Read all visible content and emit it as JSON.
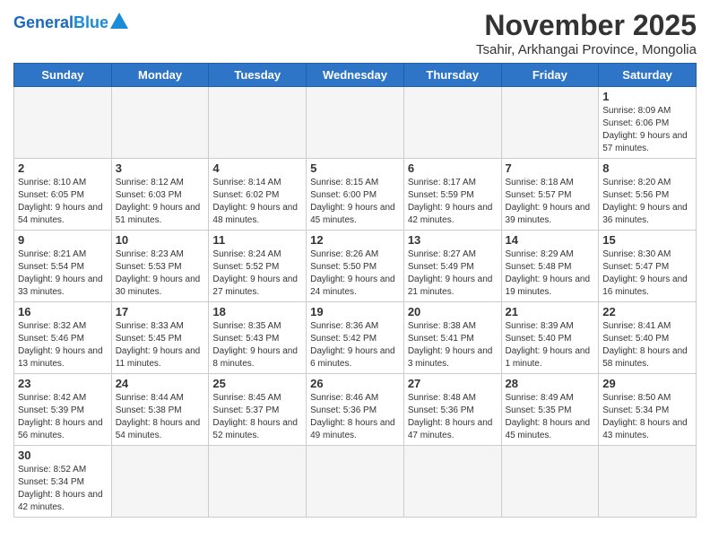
{
  "header": {
    "logo_general": "General",
    "logo_blue": "Blue",
    "month_title": "November 2025",
    "location": "Tsahir, Arkhangai Province, Mongolia"
  },
  "weekdays": [
    "Sunday",
    "Monday",
    "Tuesday",
    "Wednesday",
    "Thursday",
    "Friday",
    "Saturday"
  ],
  "weeks": [
    [
      {
        "day": "",
        "info": ""
      },
      {
        "day": "",
        "info": ""
      },
      {
        "day": "",
        "info": ""
      },
      {
        "day": "",
        "info": ""
      },
      {
        "day": "",
        "info": ""
      },
      {
        "day": "",
        "info": ""
      },
      {
        "day": "1",
        "info": "Sunrise: 8:09 AM\nSunset: 6:06 PM\nDaylight: 9 hours and 57 minutes."
      }
    ],
    [
      {
        "day": "2",
        "info": "Sunrise: 8:10 AM\nSunset: 6:05 PM\nDaylight: 9 hours and 54 minutes."
      },
      {
        "day": "3",
        "info": "Sunrise: 8:12 AM\nSunset: 6:03 PM\nDaylight: 9 hours and 51 minutes."
      },
      {
        "day": "4",
        "info": "Sunrise: 8:14 AM\nSunset: 6:02 PM\nDaylight: 9 hours and 48 minutes."
      },
      {
        "day": "5",
        "info": "Sunrise: 8:15 AM\nSunset: 6:00 PM\nDaylight: 9 hours and 45 minutes."
      },
      {
        "day": "6",
        "info": "Sunrise: 8:17 AM\nSunset: 5:59 PM\nDaylight: 9 hours and 42 minutes."
      },
      {
        "day": "7",
        "info": "Sunrise: 8:18 AM\nSunset: 5:57 PM\nDaylight: 9 hours and 39 minutes."
      },
      {
        "day": "8",
        "info": "Sunrise: 8:20 AM\nSunset: 5:56 PM\nDaylight: 9 hours and 36 minutes."
      }
    ],
    [
      {
        "day": "9",
        "info": "Sunrise: 8:21 AM\nSunset: 5:54 PM\nDaylight: 9 hours and 33 minutes."
      },
      {
        "day": "10",
        "info": "Sunrise: 8:23 AM\nSunset: 5:53 PM\nDaylight: 9 hours and 30 minutes."
      },
      {
        "day": "11",
        "info": "Sunrise: 8:24 AM\nSunset: 5:52 PM\nDaylight: 9 hours and 27 minutes."
      },
      {
        "day": "12",
        "info": "Sunrise: 8:26 AM\nSunset: 5:50 PM\nDaylight: 9 hours and 24 minutes."
      },
      {
        "day": "13",
        "info": "Sunrise: 8:27 AM\nSunset: 5:49 PM\nDaylight: 9 hours and 21 minutes."
      },
      {
        "day": "14",
        "info": "Sunrise: 8:29 AM\nSunset: 5:48 PM\nDaylight: 9 hours and 19 minutes."
      },
      {
        "day": "15",
        "info": "Sunrise: 8:30 AM\nSunset: 5:47 PM\nDaylight: 9 hours and 16 minutes."
      }
    ],
    [
      {
        "day": "16",
        "info": "Sunrise: 8:32 AM\nSunset: 5:46 PM\nDaylight: 9 hours and 13 minutes."
      },
      {
        "day": "17",
        "info": "Sunrise: 8:33 AM\nSunset: 5:45 PM\nDaylight: 9 hours and 11 minutes."
      },
      {
        "day": "18",
        "info": "Sunrise: 8:35 AM\nSunset: 5:43 PM\nDaylight: 9 hours and 8 minutes."
      },
      {
        "day": "19",
        "info": "Sunrise: 8:36 AM\nSunset: 5:42 PM\nDaylight: 9 hours and 6 minutes."
      },
      {
        "day": "20",
        "info": "Sunrise: 8:38 AM\nSunset: 5:41 PM\nDaylight: 9 hours and 3 minutes."
      },
      {
        "day": "21",
        "info": "Sunrise: 8:39 AM\nSunset: 5:40 PM\nDaylight: 9 hours and 1 minute."
      },
      {
        "day": "22",
        "info": "Sunrise: 8:41 AM\nSunset: 5:40 PM\nDaylight: 8 hours and 58 minutes."
      }
    ],
    [
      {
        "day": "23",
        "info": "Sunrise: 8:42 AM\nSunset: 5:39 PM\nDaylight: 8 hours and 56 minutes."
      },
      {
        "day": "24",
        "info": "Sunrise: 8:44 AM\nSunset: 5:38 PM\nDaylight: 8 hours and 54 minutes."
      },
      {
        "day": "25",
        "info": "Sunrise: 8:45 AM\nSunset: 5:37 PM\nDaylight: 8 hours and 52 minutes."
      },
      {
        "day": "26",
        "info": "Sunrise: 8:46 AM\nSunset: 5:36 PM\nDaylight: 8 hours and 49 minutes."
      },
      {
        "day": "27",
        "info": "Sunrise: 8:48 AM\nSunset: 5:36 PM\nDaylight: 8 hours and 47 minutes."
      },
      {
        "day": "28",
        "info": "Sunrise: 8:49 AM\nSunset: 5:35 PM\nDaylight: 8 hours and 45 minutes."
      },
      {
        "day": "29",
        "info": "Sunrise: 8:50 AM\nSunset: 5:34 PM\nDaylight: 8 hours and 43 minutes."
      }
    ],
    [
      {
        "day": "30",
        "info": "Sunrise: 8:52 AM\nSunset: 5:34 PM\nDaylight: 8 hours and 42 minutes."
      },
      {
        "day": "",
        "info": ""
      },
      {
        "day": "",
        "info": ""
      },
      {
        "day": "",
        "info": ""
      },
      {
        "day": "",
        "info": ""
      },
      {
        "day": "",
        "info": ""
      },
      {
        "day": "",
        "info": ""
      }
    ]
  ]
}
